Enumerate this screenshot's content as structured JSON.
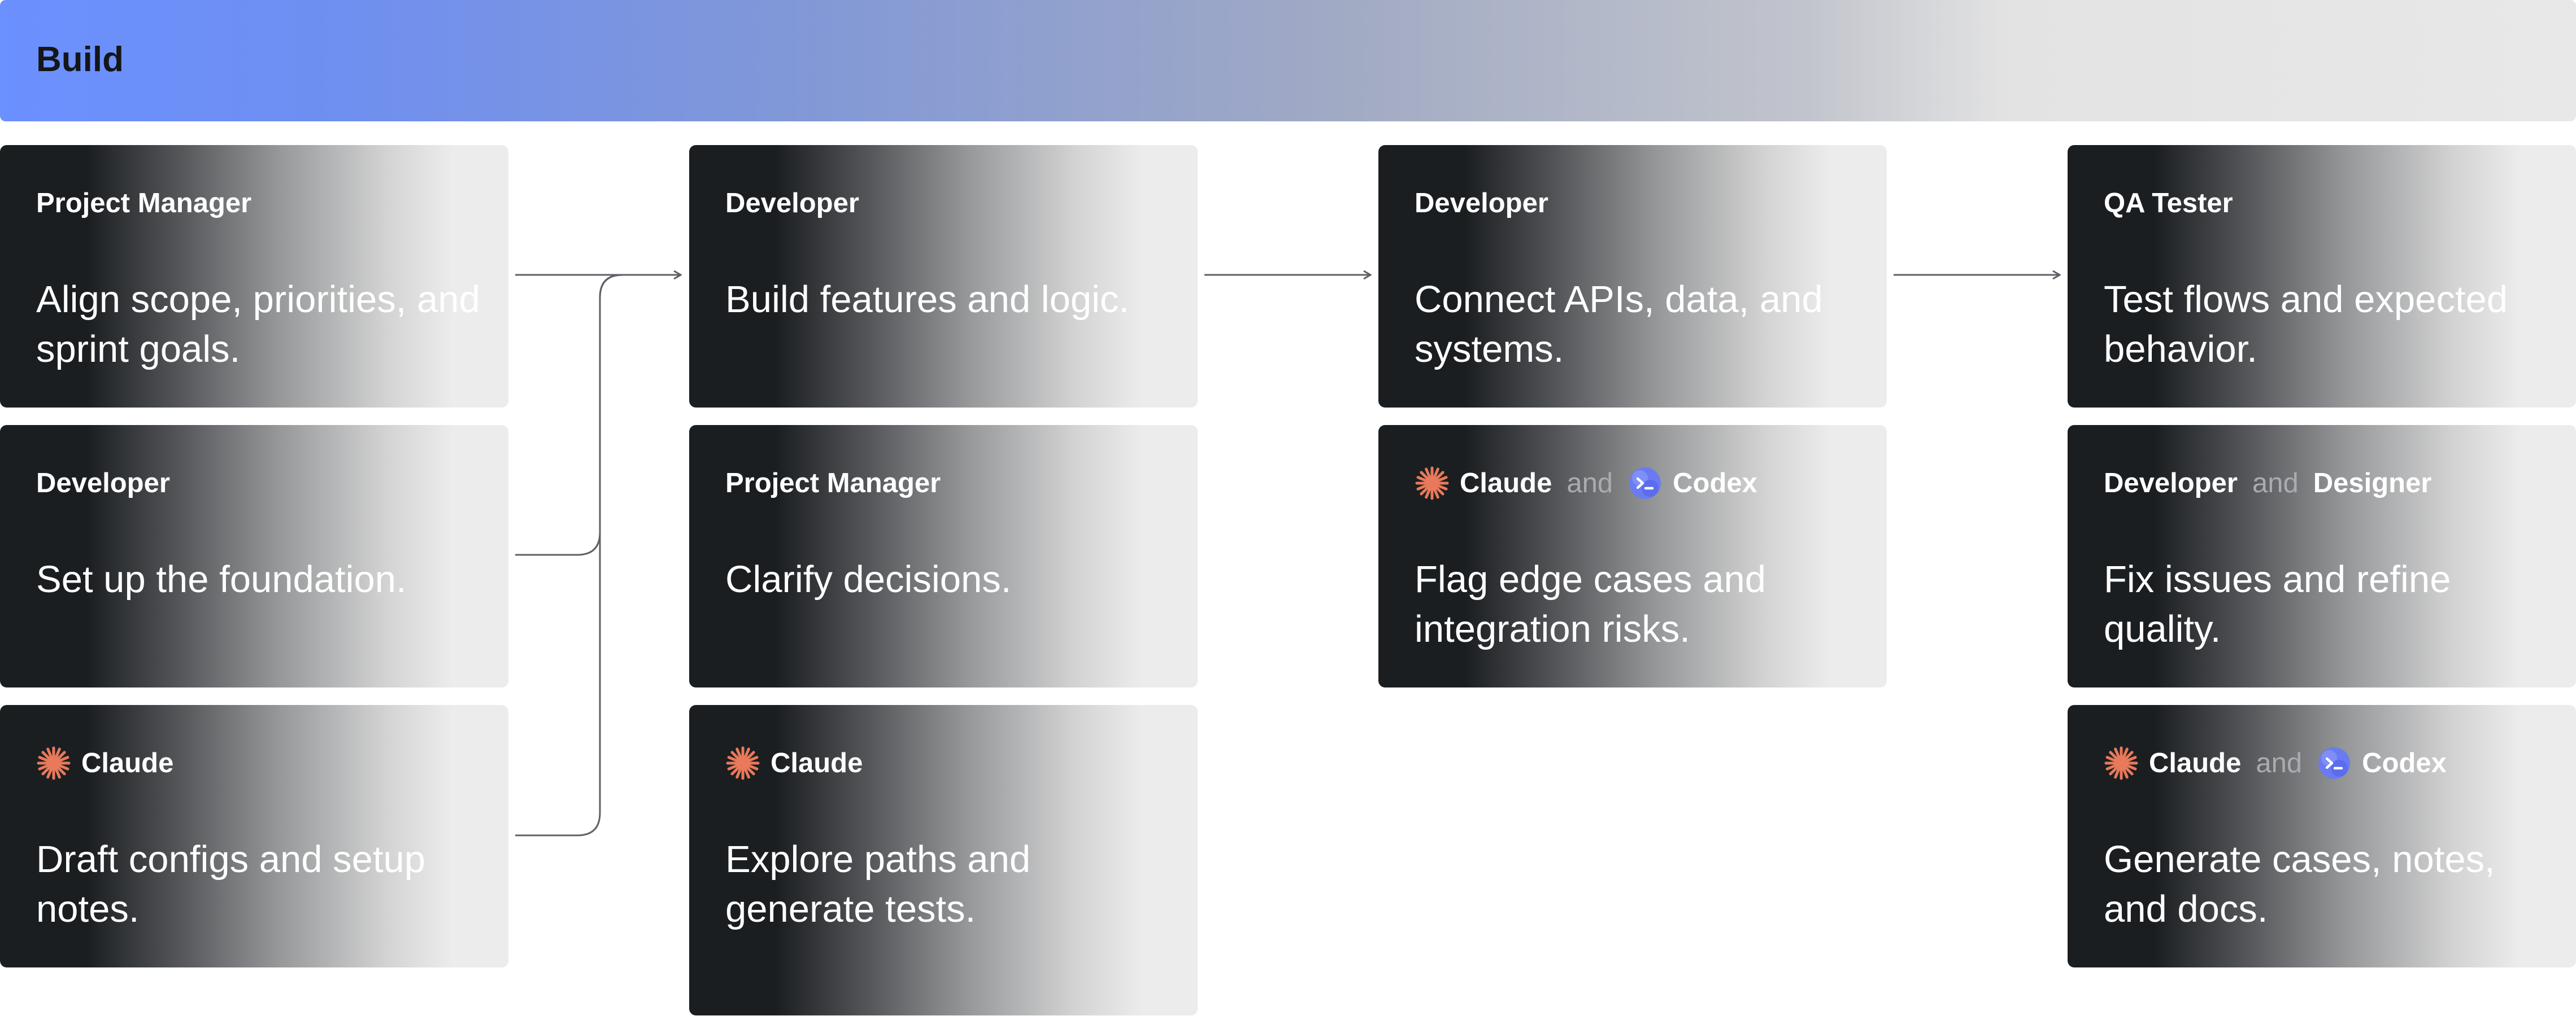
{
  "banner": {
    "title": "Build"
  },
  "colors": {
    "claude_accent": "#e8795a",
    "codex_accent": "#6a7bf2",
    "connector": "#5e6166"
  },
  "columns": [
    {
      "cards": [
        {
          "head": [
            {
              "type": "role",
              "text": "Project Manager"
            }
          ],
          "body": "Align scope, priorities, and sprint goals."
        },
        {
          "head": [
            {
              "type": "role",
              "text": "Developer"
            }
          ],
          "body": "Set up the foundation."
        },
        {
          "head": [
            {
              "type": "agent",
              "icon": "claude-icon",
              "text": "Claude"
            }
          ],
          "body": "Draft configs and setup notes."
        }
      ]
    },
    {
      "cards": [
        {
          "head": [
            {
              "type": "role",
              "text": "Developer"
            }
          ],
          "body": "Build features and logic."
        },
        {
          "head": [
            {
              "type": "role",
              "text": "Project Manager"
            }
          ],
          "body": "Clarify decisions."
        },
        {
          "head": [
            {
              "type": "agent",
              "icon": "claude-icon",
              "text": "Claude"
            }
          ],
          "body": "Explore paths and generate tests."
        }
      ]
    },
    {
      "cards": [
        {
          "head": [
            {
              "type": "role",
              "text": "Developer"
            }
          ],
          "body": "Connect APIs, data, and systems."
        },
        {
          "head": [
            {
              "type": "agent",
              "icon": "claude-icon",
              "text": "Claude"
            },
            {
              "type": "conj",
              "text": "and"
            },
            {
              "type": "agent",
              "icon": "codex-icon",
              "text": "Codex"
            }
          ],
          "body": "Flag edge cases and integration risks."
        }
      ]
    },
    {
      "cards": [
        {
          "head": [
            {
              "type": "role",
              "text": "QA Tester"
            }
          ],
          "body": "Test flows and expected behavior."
        },
        {
          "head": [
            {
              "type": "role",
              "text": "Developer"
            },
            {
              "type": "conj",
              "text": "and"
            },
            {
              "type": "role",
              "text": "Designer"
            }
          ],
          "body": "Fix issues and refine quality."
        },
        {
          "head": [
            {
              "type": "agent",
              "icon": "claude-icon",
              "text": "Claude"
            },
            {
              "type": "conj",
              "text": "and"
            },
            {
              "type": "agent",
              "icon": "codex-icon",
              "text": "Codex"
            }
          ],
          "body": "Generate cases, notes, and docs."
        }
      ]
    }
  ]
}
